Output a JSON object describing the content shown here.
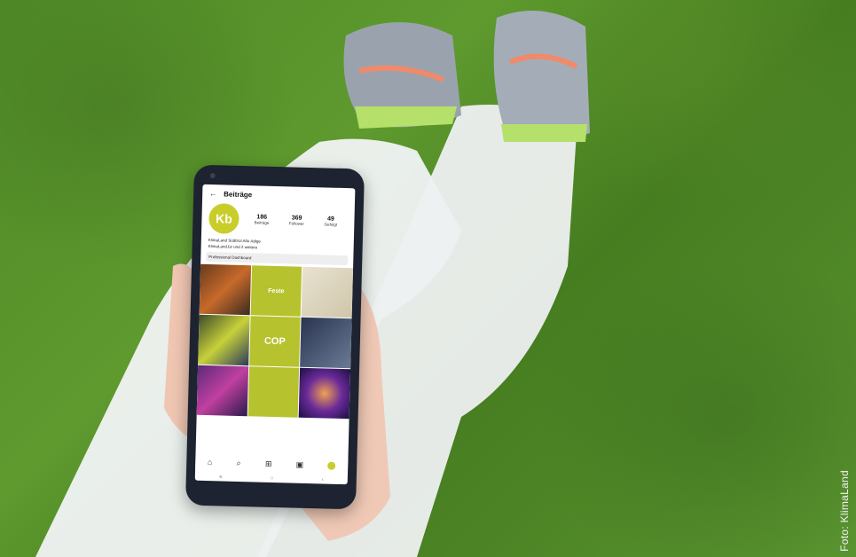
{
  "photo": {
    "description_tag": "phone-in-hand-on-grass"
  },
  "credit": "Foto: KlimaLand",
  "phone_screen": {
    "header_title": "Beiträge",
    "avatar_text": "Kb",
    "stats": [
      {
        "value": "186",
        "label": "Beiträge"
      },
      {
        "value": "369",
        "label": "Follower"
      },
      {
        "value": "49",
        "label": "Gefolgt"
      }
    ],
    "bio_line_1": "KlimaLand Südtirol Alto Adige",
    "bio_line_2": "KlimaLand.bz und 2 weitere",
    "dashboard_label": "Professional Dashboard",
    "tiles": [
      "",
      "Feste",
      "",
      "",
      "COP",
      "",
      "",
      "",
      ""
    ],
    "nav_icons": [
      "home-icon",
      "search-icon",
      "add-icon",
      "reels-icon",
      "profile-icon"
    ]
  },
  "colors": {
    "accent": "#b6c22e",
    "grass": "#4f8a26"
  }
}
